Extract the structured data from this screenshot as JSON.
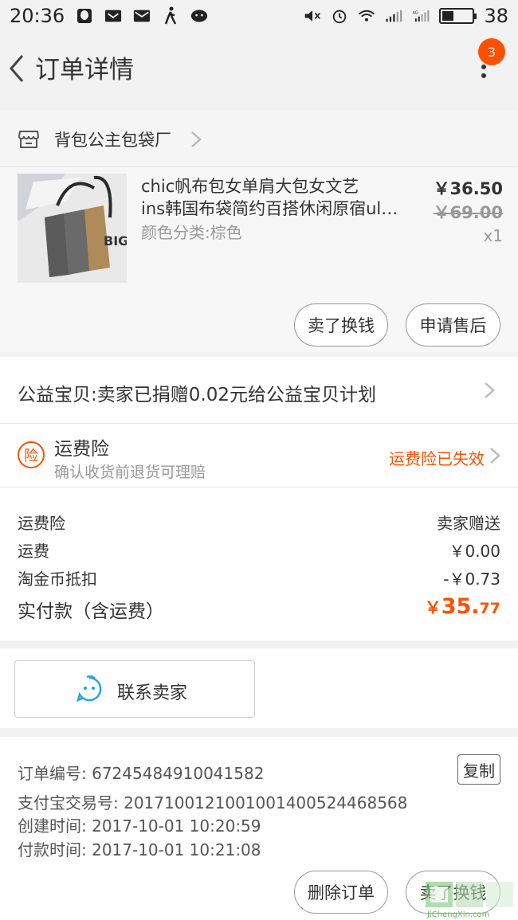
{
  "status_bar": {
    "time": "20:36",
    "battery": "38",
    "battery_level": 0.38,
    "network": "4G"
  },
  "header": {
    "title": "订单详情",
    "notification_count": "3"
  },
  "shop": {
    "name": "背包公主包袋厂"
  },
  "item": {
    "title_line1": "chic帆布包女单肩大包女文艺",
    "title_line2": "ins韩国布袋简约百搭休闲原宿ulzzang",
    "spec": "颜色分类:棕色",
    "price": "￥36.50",
    "original_price": "￥69.00",
    "quantity": "x1",
    "buttons": {
      "sell": "卖了换钱",
      "after_sale": "申请售后"
    },
    "thumb_text": "BIG-"
  },
  "charity": {
    "text": "公益宝贝:卖家已捐赠0.02元给公益宝贝计划"
  },
  "insurance": {
    "icon_label": "险",
    "title": "运费险",
    "subtitle": "确认收货前退货可理赔",
    "status": "运费险已失效"
  },
  "fees": {
    "lines": [
      {
        "label": "运费险",
        "value": "卖家赠送"
      },
      {
        "label": "运费",
        "value": "￥0.00"
      },
      {
        "label": "淘金币抵扣",
        "value": "-￥0.73"
      }
    ],
    "total_label": "实付款（含运费）",
    "total_currency": "￥",
    "total_integer": "35.",
    "total_decimal": "77"
  },
  "contact": {
    "label": "联系卖家"
  },
  "order_info": {
    "order_no": "订单编号:  67245484910041582",
    "alipay_no": "支付宝交易号:  2017100121001001400524468568",
    "created": "创建时间:  2017-10-01 10:20:59",
    "paid": "付款时间:  2017-10-01 10:21:08",
    "copy_label": "复制"
  },
  "bottom_bar": {
    "delete_label": "删除订单",
    "sell_label": "卖了换钱"
  },
  "watermark": {
    "text": "JiChengXin.com"
  },
  "colors": {
    "accent": "#ff5000",
    "background": "#f2f2f2"
  }
}
